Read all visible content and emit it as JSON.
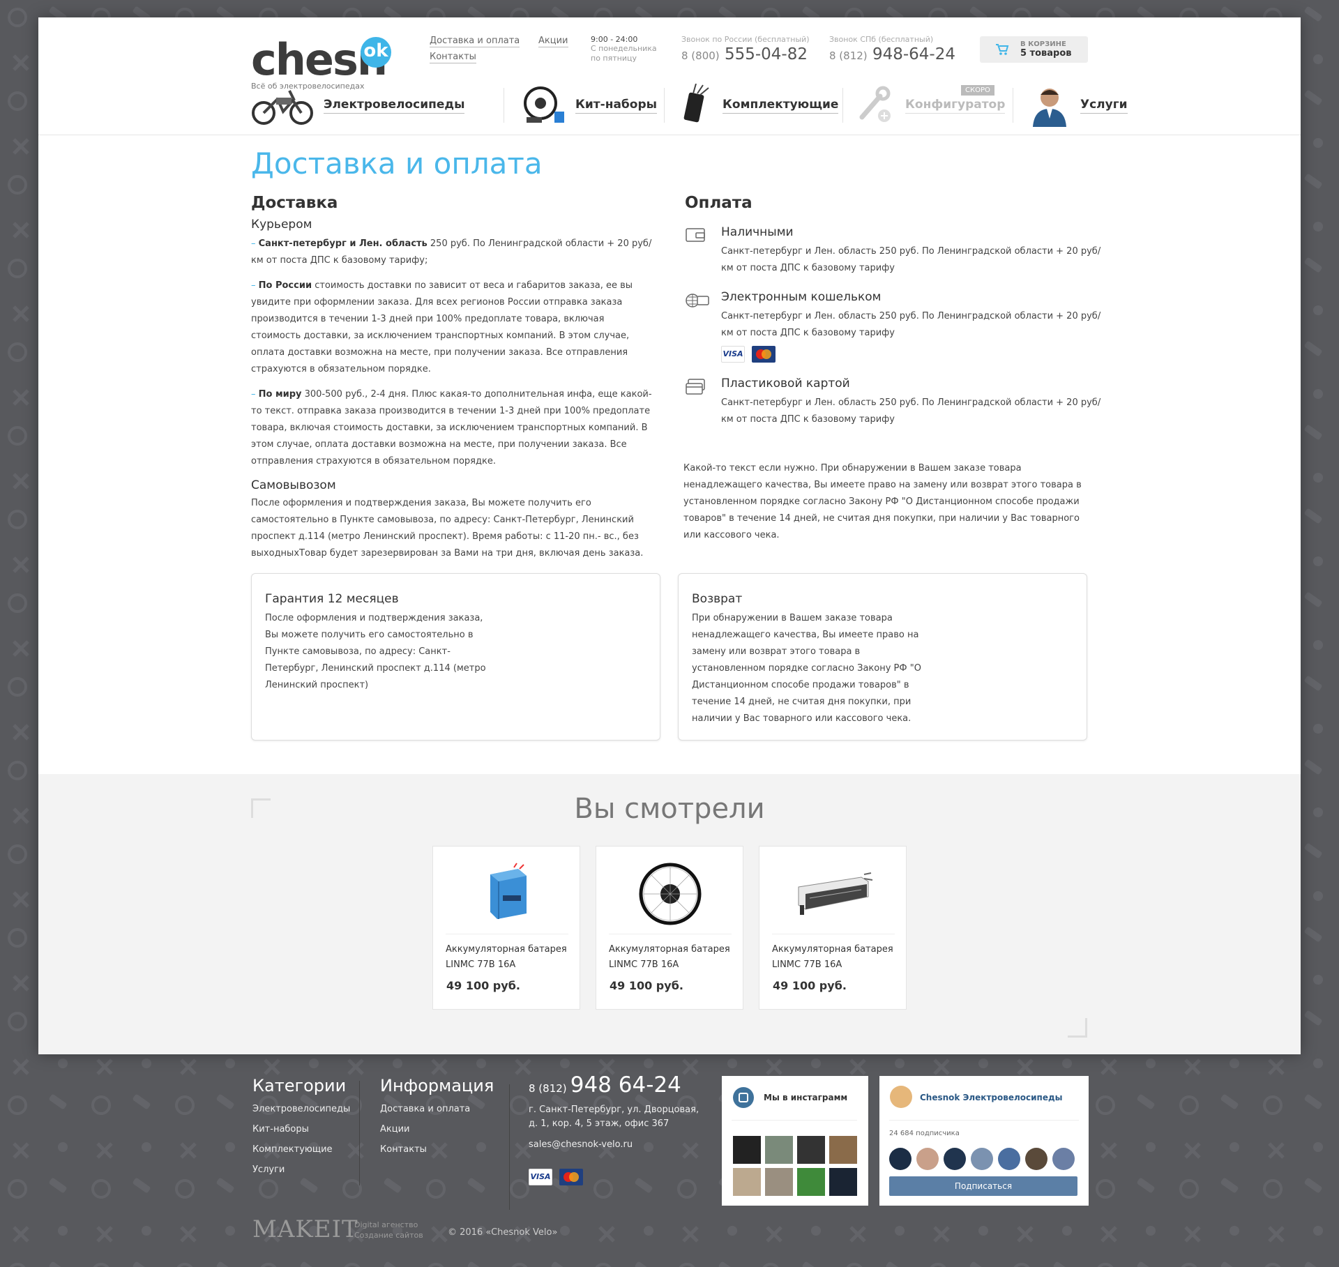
{
  "header": {
    "logo_main": "chesn",
    "logo_ok": "ok",
    "tagline": "Всё об электровелосипедах",
    "links": [
      "Доставка и оплата",
      "Акции",
      "Контакты"
    ],
    "hours": "9:00 - 24:00",
    "hours_note_1": "С понедельника",
    "hours_note_2": "по пятницу",
    "phone_russia_label": "Звонок по России (бесплатный)",
    "phone_russia_prefix": "8 (800)",
    "phone_russia_number": "555-04-82",
    "phone_spb_label": "Звонок СПб (бесплатный)",
    "phone_spb_prefix": "8 (812)",
    "phone_spb_number": "948-64-24",
    "cart_line1": "в корзине",
    "cart_line2": "5 товаров"
  },
  "nav": {
    "items": [
      {
        "label": "Электровелосипеды",
        "icon": "ebike-icon"
      },
      {
        "label": "Кит-наборы",
        "icon": "kit-wheel-icon"
      },
      {
        "label": "Комплектующие",
        "icon": "controller-icon"
      },
      {
        "label": "Конфигуратор",
        "icon": "wrench-plus-icon",
        "badge": "СКОРО"
      },
      {
        "label": "Услуги",
        "icon": "person-photo-icon"
      }
    ]
  },
  "page_title": "Доставка и оплата",
  "delivery": {
    "heading": "Доставка",
    "courier_heading": "Курьером",
    "p1_bold": "Санкт-петербург и Лен. область",
    "p1_text": " 250 руб. По Ленинградской области + 20 руб/км от поста ДПС к базовому тарифу;",
    "p2_bold": "По России",
    "p2_text": " стоимость доставки по зависит от веса и габаритов заказа, ее вы увидите при оформлении заказа. Для всех регионов России отправка заказа производится в течении 1-3 дней при 100% предоплате товара, включая стоимость доставки, за исключением транспортных компаний. В этом случае, оплата доставки возможна на месте, при получении заказа. Все отправления страхуются в обязательном порядке.",
    "p3_bold": "По миру",
    "p3_text": " 300-500 руб., 2-4 дня. Плюс какая-то дополнительная инфа, еще какой-то текст. отправка заказа производится в течении 1-3 дней при 100% предоплате товара, включая стоимость доставки, за исключением транспортных компаний. В этом случае, оплата доставки возможна на месте, при получении заказа. Все отправления страхуются в обязательном порядке.",
    "pickup_heading": "Самовывозом",
    "pickup_text": "После оформления и подтверждения заказа, Вы можете получить его самостоятельно в Пункте самовывоза, по адресу: Санкт-Петербург, Ленинский проспект д.114 (метро Ленинский проспект).  Время работы: с 11-20 пн.- вс., без выходныхТовар будет зарезервирован за Вами на три дня, включая день заказа."
  },
  "payment": {
    "heading": "Оплата",
    "methods": [
      {
        "title": "Наличными",
        "icon": "wallet-icon",
        "text": "Санкт-петербург и Лен. область  250 руб. По Ленинградской области + 20 руб/км от поста ДПС к базовому тарифу"
      },
      {
        "title": "Электронным кошельком",
        "icon": "globe-card-icon",
        "text": "Санкт-петербург и Лен. область  250 руб. По Ленинградской области + 20 руб/км от поста ДПС к базовому тарифу"
      },
      {
        "title": "Пластиковой картой",
        "icon": "cards-icon",
        "text": "Санкт-петербург и Лен. область  250 руб. По Ленинградской области + 20 руб/км от поста ДПС к базовому тарифу"
      }
    ],
    "visa": "VISA",
    "note": "Какой-то текст если нужно. При обнаружении в Вашем заказе товара ненадлежащего качества, Вы имеете право на замену или возврат этого товара в установленном порядке согласно Закону РФ \"О Дистанционном способе продажи товаров\" в течение 14 дней, не считая дня покупки, при наличии у Вас товарного или кассового чека."
  },
  "boxes": {
    "warranty_title": "Гарантия 12 месяцев",
    "warranty_text": "После оформления и подтверждения заказа, Вы можете получить его самостоятельно в Пункте самовывоза, по адресу: Санкт-Петербург, Ленинский проспект д.114 (метро Ленинский проспект)",
    "return_title": "Возврат",
    "return_text": "При обнаружении в Вашем заказе товара ненадлежащего качества, Вы имеете право на замену или возврат этого товара в установленном порядке согласно Закону РФ \"О Дистанционном способе продажи товаров\" в течение 14 дней, не считая дня покупки, при наличии у Вас товарного или кассового чека."
  },
  "viewed": {
    "heading": "Вы смотрели",
    "products": [
      {
        "name_1": "Аккумуляторная батарея",
        "name_2": "LINMC 77B 16A",
        "price": "49 100 руб.",
        "image": "battery-image"
      },
      {
        "name_1": "Аккумуляторная батарея",
        "name_2": "LINMC 77B 16A",
        "price": "49 100 руб.",
        "image": "motor-wheel-image"
      },
      {
        "name_1": "Аккумуляторная батарея",
        "name_2": "LINMC 77B 16A",
        "price": "49 100 руб.",
        "image": "controller-image"
      }
    ]
  },
  "footer": {
    "categories_heading": "Категории",
    "categories": [
      "Электровелосипеды",
      "Кит-наборы",
      "Комплектующие",
      "Услуги"
    ],
    "info_heading": "Информация",
    "info": [
      "Доставка и оплата",
      "Акции",
      "Контакты"
    ],
    "phone_prefix": "8 (812)",
    "phone_number": "948 64-24",
    "address_1": "г. Санкт-Петербург, ул. Дворцовая,",
    "address_2": "д. 1, кор. 4, 5 этаж, офис 367",
    "email": "sales@chesnok-velo.ru",
    "visa": "VISA",
    "instagram_title": "Мы в инстаграмм",
    "vk_title": "Chesnok Электровелосипеды",
    "vk_subs": "24 684 подписчика",
    "vk_button": "Подписаться",
    "makeit_logo": "MAKEIT",
    "makeit_line1": "Digital агенство",
    "makeit_line2": "Создание сайтов",
    "copyright": "© 2016 «Chesnok Velo»"
  },
  "colors": {
    "accent": "#4ab7ea",
    "footer_bg": "#58595d",
    "vk_button": "#5b7fa6"
  }
}
